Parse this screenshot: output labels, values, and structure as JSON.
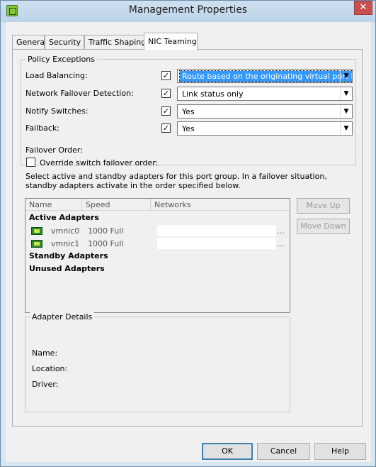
{
  "window": {
    "title": "Management Properties",
    "close": "✕"
  },
  "tabs": [
    "General",
    "Security",
    "Traffic Shaping",
    "NIC Teaming"
  ],
  "policy": {
    "group_title": "Policy Exceptions",
    "rows": [
      {
        "label": "Load Balancing:",
        "checked": "✓",
        "value": "Route based on the originating virtual port ID"
      },
      {
        "label": "Network Failover Detection:",
        "checked": "✓",
        "value": "Link status only"
      },
      {
        "label": "Notify Switches:",
        "checked": "✓",
        "value": "Yes"
      },
      {
        "label": "Failback:",
        "checked": "✓",
        "value": "Yes"
      }
    ],
    "failover_order_label": "Failover Order:",
    "override_label": "Override switch failover order:",
    "description": "Select active and standby adapters for this port group.  In a failover situation, standby adapters activate  in the order specified below."
  },
  "adapters": {
    "columns": [
      "Name",
      "Speed",
      "Networks"
    ],
    "active_title": "Active Adapters",
    "active": [
      {
        "name": "vmnic0",
        "speed": "1000 Full",
        "networks": "..."
      },
      {
        "name": "vmnic1",
        "speed": "1000 Full",
        "networks": "..."
      }
    ],
    "standby_title": "Standby Adapters",
    "unused_title": "Unused Adapters"
  },
  "side_buttons": {
    "move_up": "Move Up",
    "move_down": "Move Down"
  },
  "details": {
    "title": "Adapter Details",
    "name": "Name:",
    "location": "Location:",
    "driver": "Driver:"
  },
  "footer": {
    "ok": "OK",
    "cancel": "Cancel",
    "help": "Help"
  }
}
